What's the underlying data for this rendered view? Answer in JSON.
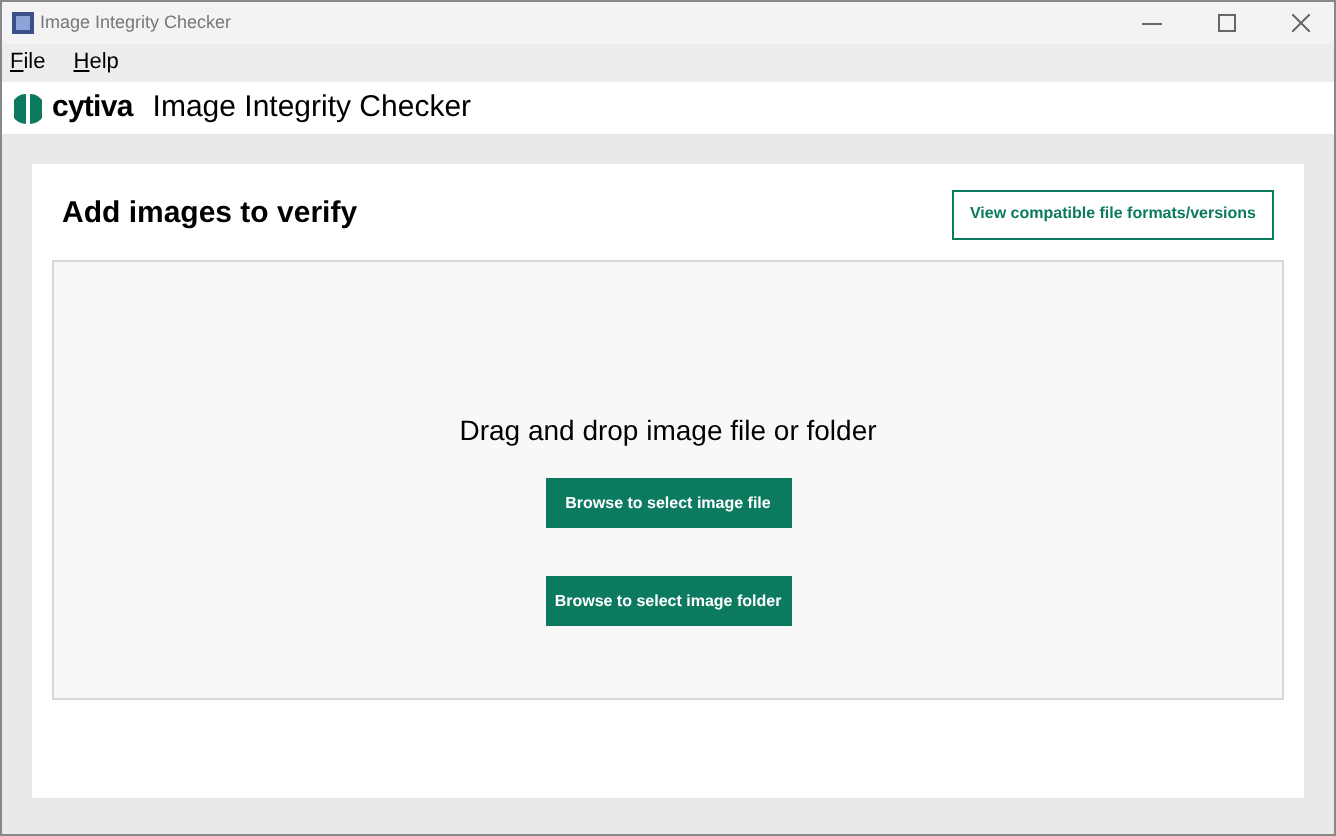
{
  "window": {
    "title": "Image Integrity Checker"
  },
  "menu": [
    "File",
    "Help"
  ],
  "header": {
    "logo_text": "cytiva",
    "title": "Image Integrity Checker"
  },
  "card": {
    "heading": "Add images to verify",
    "link_button": "View compatible file formats/versions",
    "drop_zone": {
      "prompt": "Drag and drop image file or folder",
      "buttons": [
        "Browse to select image file",
        "Browse to select image folder"
      ]
    }
  }
}
